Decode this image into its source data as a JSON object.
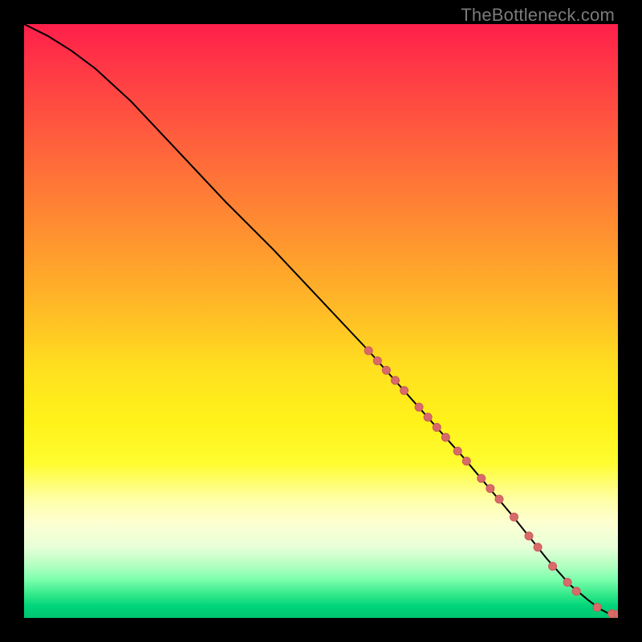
{
  "attribution": "TheBottleneck.com",
  "chart_data": {
    "type": "line",
    "title": "",
    "xlabel": "",
    "ylabel": "",
    "xlim": [
      0,
      100
    ],
    "ylim": [
      0,
      100
    ],
    "grid": false,
    "series": [
      {
        "name": "curve",
        "x": [
          0,
          4,
          8,
          12,
          18,
          26,
          34,
          42,
          50,
          58,
          66,
          74,
          82,
          88,
          92,
          95,
          97,
          98.5,
          100
        ],
        "y": [
          100,
          98,
          95.5,
          92.5,
          87,
          78.5,
          70,
          62,
          53.5,
          45,
          36,
          27,
          17.5,
          10,
          5.5,
          3,
          1.5,
          0.7,
          0.6
        ]
      }
    ],
    "markers": [
      {
        "x": 58.0,
        "y": 45.0,
        "r": 5
      },
      {
        "x": 59.5,
        "y": 43.3,
        "r": 5
      },
      {
        "x": 61.0,
        "y": 41.7,
        "r": 5
      },
      {
        "x": 62.5,
        "y": 40.0,
        "r": 5
      },
      {
        "x": 64.0,
        "y": 38.3,
        "r": 5
      },
      {
        "x": 66.5,
        "y": 35.5,
        "r": 5
      },
      {
        "x": 68.0,
        "y": 33.8,
        "r": 5
      },
      {
        "x": 69.5,
        "y": 32.1,
        "r": 5
      },
      {
        "x": 71.0,
        "y": 30.4,
        "r": 5
      },
      {
        "x": 73.0,
        "y": 28.1,
        "r": 5
      },
      {
        "x": 74.5,
        "y": 26.4,
        "r": 5
      },
      {
        "x": 77.0,
        "y": 23.5,
        "r": 5
      },
      {
        "x": 78.5,
        "y": 21.8,
        "r": 5
      },
      {
        "x": 80.0,
        "y": 20.0,
        "r": 5
      },
      {
        "x": 82.5,
        "y": 17.0,
        "r": 5
      },
      {
        "x": 85.0,
        "y": 13.8,
        "r": 5
      },
      {
        "x": 86.5,
        "y": 11.9,
        "r": 5
      },
      {
        "x": 89.0,
        "y": 8.7,
        "r": 5
      },
      {
        "x": 91.5,
        "y": 6.0,
        "r": 5
      },
      {
        "x": 93.0,
        "y": 4.5,
        "r": 5
      },
      {
        "x": 96.5,
        "y": 1.8,
        "r": 5
      },
      {
        "x": 99.0,
        "y": 0.7,
        "r": 5
      },
      {
        "x": 100.0,
        "y": 0.6,
        "r": 5
      }
    ],
    "colors": {
      "curve": "#000000",
      "marker_fill": "#d96a6a",
      "marker_stroke": "#c85a5a"
    }
  }
}
